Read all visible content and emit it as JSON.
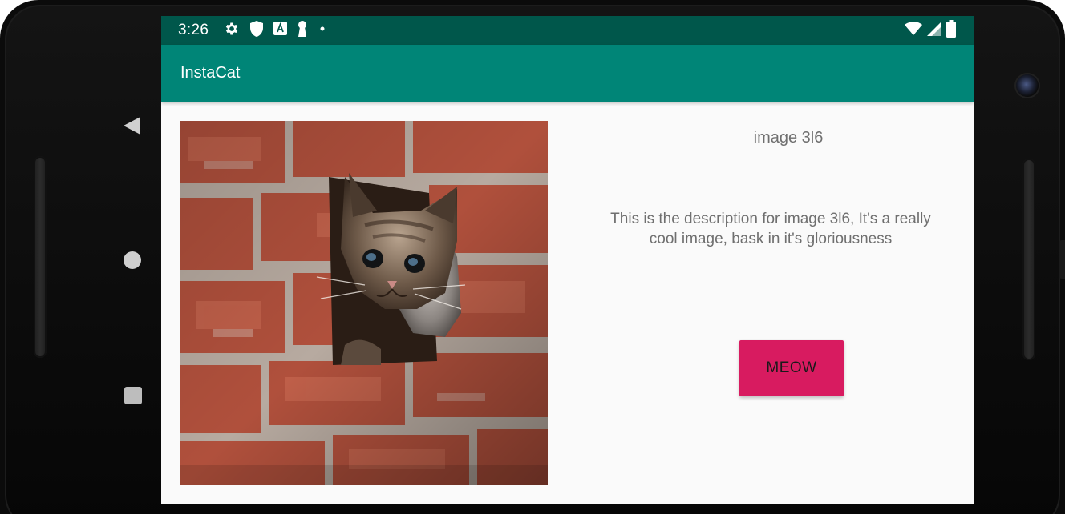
{
  "status_bar": {
    "time": "3:26",
    "left_icons": [
      "settings-icon",
      "shield-icon",
      "font-icon",
      "keyhole-icon",
      "dot-icon"
    ],
    "right_icons": [
      "wifi-icon",
      "signal-icon",
      "battery-icon"
    ]
  },
  "app_bar": {
    "title": "InstaCat"
  },
  "content": {
    "image_alt": "kitten-peeking-from-brick-wall",
    "image_title": "image 3l6",
    "description": "This is the description for image 3l6, It's a really cool image, bask in it's gloriousness",
    "button_label": "MEOW"
  },
  "nav": {
    "icons": [
      "back-icon",
      "home-icon",
      "recents-icon"
    ]
  },
  "colors": {
    "status_bar": "#00574b",
    "app_bar": "#008577",
    "accent": "#d81b60",
    "background": "#fafafa"
  }
}
